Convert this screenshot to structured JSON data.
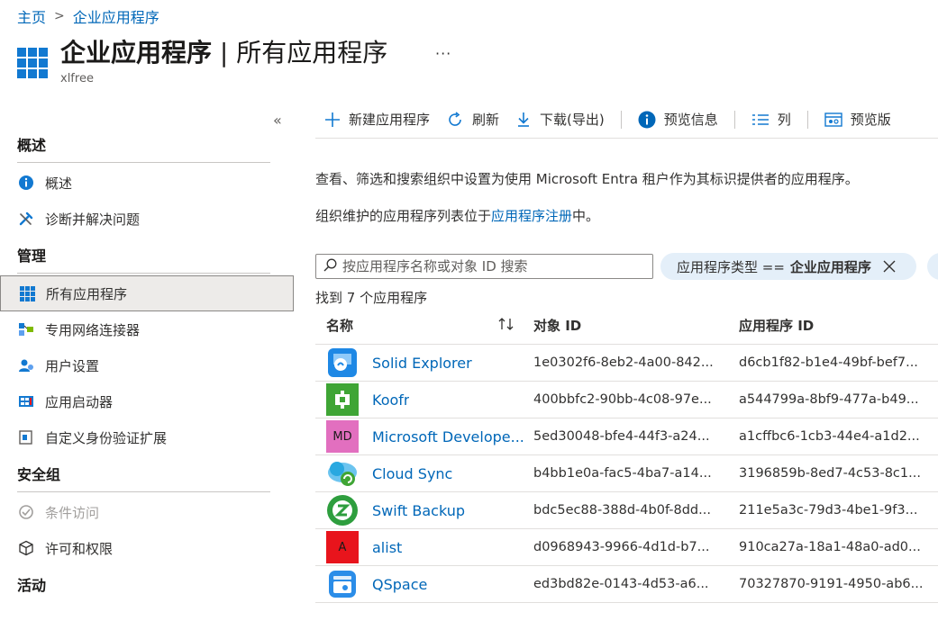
{
  "breadcrumb": {
    "home": "主页",
    "current": "企业应用程序"
  },
  "header": {
    "title_bold": "企业应用程序",
    "title_rest": " | 所有应用程序",
    "tenant": "xlfree",
    "more": "···"
  },
  "sidebar": {
    "collapse": "«",
    "groups": [
      {
        "title": "概述",
        "items": [
          {
            "label": "概述",
            "icon": "info-icon"
          },
          {
            "label": "诊断并解决问题",
            "icon": "wrench-icon"
          }
        ]
      },
      {
        "title": "管理",
        "items": [
          {
            "label": "所有应用程序",
            "icon": "grid-icon",
            "active": true
          },
          {
            "label": "专用网络连接器",
            "icon": "connector-icon"
          },
          {
            "label": "用户设置",
            "icon": "user-settings-icon"
          },
          {
            "label": "应用启动器",
            "icon": "launcher-icon"
          },
          {
            "label": "自定义身份验证扩展",
            "icon": "extension-icon"
          }
        ]
      },
      {
        "title": "安全组",
        "items": [
          {
            "label": "条件访问",
            "icon": "conditional-access-icon",
            "disabled": true
          },
          {
            "label": "许可和权限",
            "icon": "cube-icon"
          }
        ]
      },
      {
        "title": "活动",
        "items": []
      }
    ]
  },
  "toolbar": {
    "new_app": "新建应用程序",
    "refresh": "刷新",
    "download": "下载(导出)",
    "preview_info": "预览信息",
    "columns": "列",
    "preview_features": "预览版"
  },
  "description": {
    "line1": "查看、筛选和搜索组织中设置为使用 Microsoft Entra 租户作为其标识提供者的应用程序。",
    "line2_prefix": "组织维护的应用程序列表位于",
    "line2_link": "应用程序注册",
    "line2_suffix": "中。"
  },
  "search": {
    "placeholder": "按应用程序名称或对象 ID 搜索"
  },
  "filter": {
    "label": "应用程序类型 ==",
    "value": "企业应用程序"
  },
  "count_text": "找到 7 个应用程序",
  "table": {
    "headers": {
      "name": "名称",
      "object_id": "对象 ID",
      "app_id": "应用程序 ID"
    },
    "rows": [
      {
        "name": "Solid Explorer",
        "object_id": "1e0302f6-8eb2-4a00-842...",
        "app_id": "d6cb1f82-b1e4-49bf-bef7...",
        "logo": "solid-explorer-logo",
        "color": "#1e88e5"
      },
      {
        "name": "Koofr",
        "object_id": "400bbfc2-90bb-4c08-97e...",
        "app_id": "a544799a-8bf9-477a-b49...",
        "logo": "koofr-logo",
        "color": "#3fa535"
      },
      {
        "name": "Microsoft Develope...",
        "object_id": "5ed30048-bfe4-44f3-a24...",
        "app_id": "a1cffbc6-1cb3-44e4-a1d2...",
        "logo_text": "MD",
        "color": "#e26fbf"
      },
      {
        "name": "Cloud Sync",
        "object_id": "b4bb1e0a-fac5-4ba7-a14...",
        "app_id": "3196859b-8ed7-4c53-8c1...",
        "logo": "cloud-sync-logo",
        "color": "#29a8e0"
      },
      {
        "name": "Swift Backup",
        "object_id": "bdc5ec88-388d-4b0f-8dd...",
        "app_id": "211e5a3c-79d3-4be1-9f3...",
        "logo": "swift-backup-logo",
        "color": "#2e9e3e"
      },
      {
        "name": "alist",
        "object_id": "d0968943-9966-4d1d-b7...",
        "app_id": "910ca27a-18a1-48a0-ad0...",
        "logo_text": "A",
        "color": "#e8141c"
      },
      {
        "name": "QSpace",
        "object_id": "ed3bd82e-0143-4d53-a6...",
        "app_id": "70327870-9191-4950-ab6...",
        "logo": "qspace-logo",
        "color": "#2b8de8"
      }
    ]
  }
}
